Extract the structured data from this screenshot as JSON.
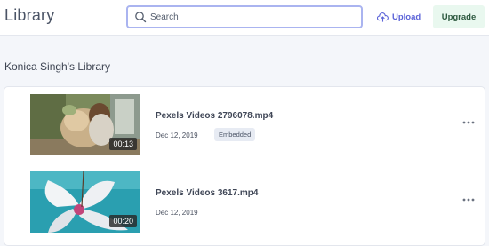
{
  "header": {
    "title": "Library",
    "search": {
      "placeholder": "Search",
      "value": ""
    },
    "upload_label": "Upload",
    "upgrade_label": "Upgrade"
  },
  "library": {
    "heading": "Konica Singh's Library",
    "videos": [
      {
        "title": "Pexels Videos 2796078.mp4",
        "date": "Dec 12, 2019",
        "duration": "00:13",
        "badge": "Embedded"
      },
      {
        "title": "Pexels Videos 3617.mp4",
        "date": "Dec 12, 2019",
        "duration": "00:20",
        "badge": ""
      }
    ]
  },
  "colors": {
    "accent": "#5b63d8",
    "upgrade_bg": "#e9f8ef",
    "background": "#f4f6fa"
  },
  "icons": [
    "search-icon",
    "upload-icon",
    "more-icon"
  ]
}
